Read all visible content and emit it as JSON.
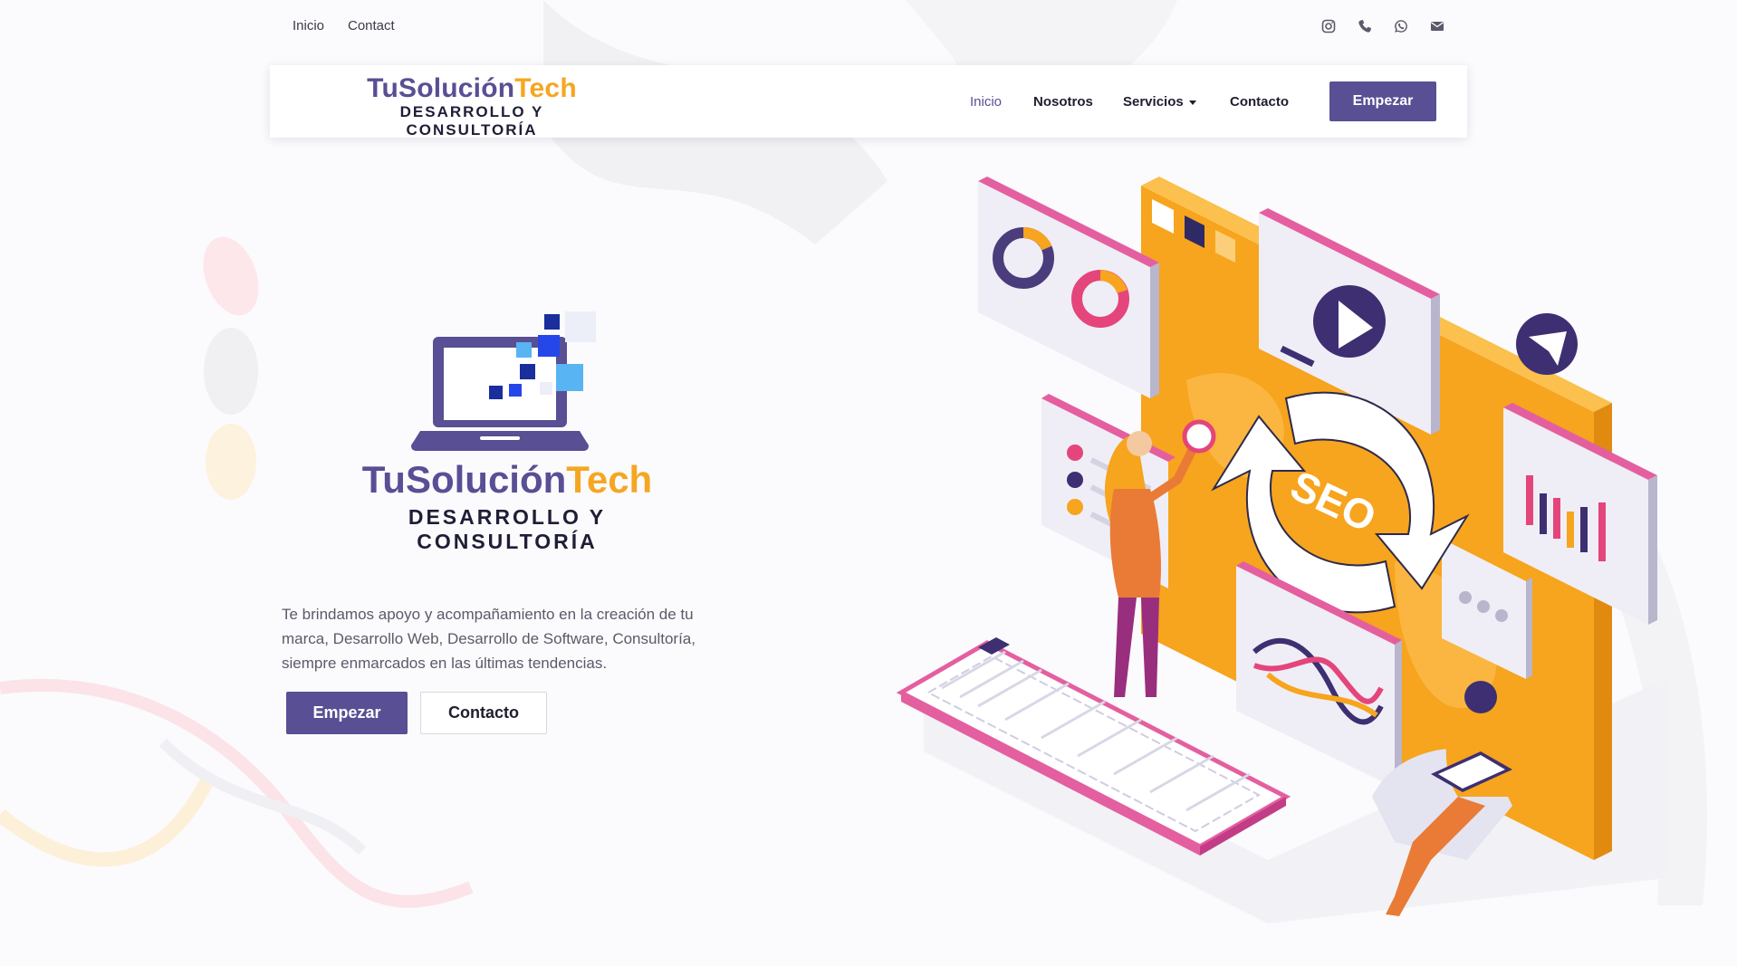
{
  "topbar": {
    "links": [
      "Inicio",
      "Contact"
    ],
    "social_icons": [
      "instagram-icon",
      "phone-icon",
      "whatsapp-icon",
      "email-icon"
    ]
  },
  "header": {
    "logo": {
      "title_part1": "TuSolución",
      "title_part2": "Tech",
      "subtitle": "DESARROLLO Y CONSULTORÍA"
    },
    "nav": [
      {
        "label": "Inicio",
        "active": true
      },
      {
        "label": "Nosotros",
        "active": false
      },
      {
        "label": "Servicios",
        "active": false,
        "has_dropdown": true
      },
      {
        "label": "Contacto",
        "active": false
      }
    ],
    "cta_label": "Empezar"
  },
  "hero": {
    "logo": {
      "title_part1": "TuSolución",
      "title_part2": "Tech",
      "subtitle": "DESARROLLO Y CONSULTORÍA"
    },
    "description": "Te brindamos apoyo y acompañamiento en la creación de tu marca, Desarrollo Web, Desarrollo de Software, Consultoría, siempre enmarcados en las últimas tendencias.",
    "primary_button": "Empezar",
    "secondary_button": "Contacto"
  },
  "illustration": {
    "seo_label": "SEO"
  },
  "colors": {
    "brand_purple": "#584f94",
    "brand_orange": "#f5a623",
    "dark_text": "#1e1e36"
  }
}
